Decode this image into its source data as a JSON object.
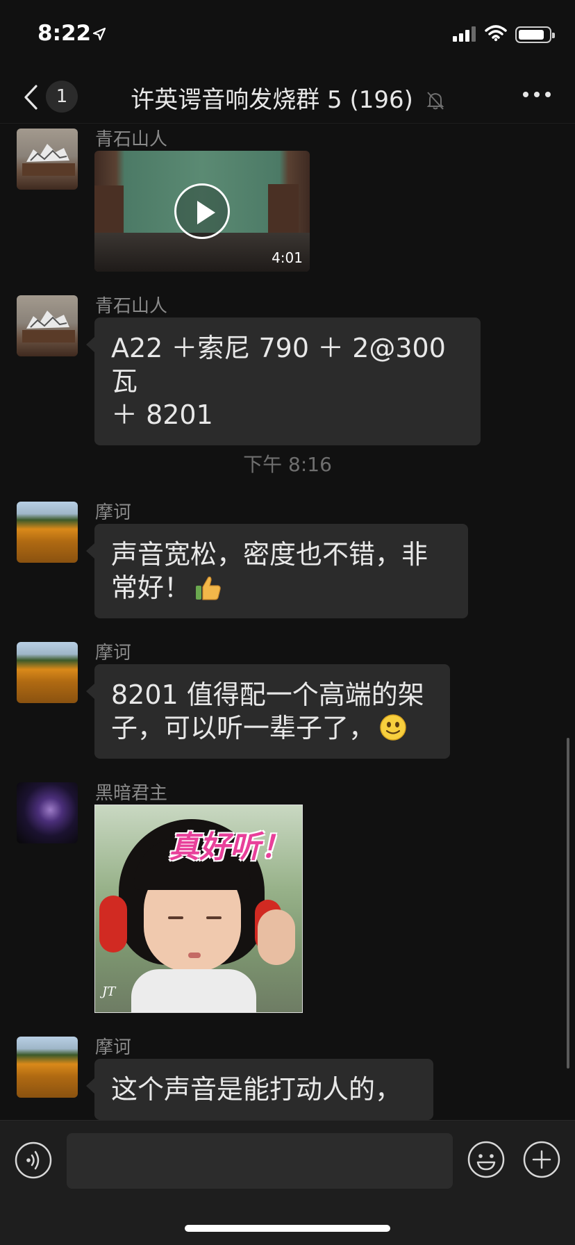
{
  "status_bar": {
    "time": "8:22",
    "icons": [
      "location-arrow-icon",
      "signal-icon",
      "wifi-icon",
      "battery-icon"
    ]
  },
  "nav": {
    "back_badge": "1",
    "title": "许英谔音响发烧群 5 (196)",
    "icons": [
      "back-icon",
      "mute-bell-icon",
      "more-icon"
    ]
  },
  "messages": [
    {
      "type": "video",
      "sender": "青石山人",
      "avatar": "rock-avatar",
      "duration": "4:01"
    },
    {
      "type": "text",
      "sender": "青石山人",
      "avatar": "rock-avatar",
      "lines": [
        "A22 ＋索尼 790 ＋ 2@300 瓦",
        "＋ 8201"
      ]
    },
    {
      "type": "timestamp",
      "text": "下午 8:16"
    },
    {
      "type": "text",
      "sender": "摩诃",
      "avatar": "flower-field-avatar",
      "lines": [
        "声音宽松，密度也不错，非",
        "常好！"
      ],
      "emoji": "thumbs-up-icon"
    },
    {
      "type": "text",
      "sender": "摩诃",
      "avatar": "flower-field-avatar",
      "lines": [
        "8201 值得配一个高端的架",
        "子，可以听一辈子了，"
      ],
      "emoji": "smile-icon"
    },
    {
      "type": "sticker",
      "sender": "黑暗君主",
      "avatar": "dark-warrior-avatar",
      "caption": "真好听！",
      "signature": "JT"
    },
    {
      "type": "text",
      "sender": "摩诃",
      "avatar": "flower-field-avatar",
      "lines": [
        "这个声音是能打动人的，"
      ]
    }
  ],
  "input_bar": {
    "value": "",
    "icons": [
      "voice-icon",
      "emoji-icon",
      "plus-icon"
    ]
  },
  "colors": {
    "background": "#111111",
    "bubble": "#2b2b2b",
    "sender_name": "#8a8a8a",
    "timestamp": "#6f6f6f",
    "input_bar": "#1e1e1e"
  }
}
